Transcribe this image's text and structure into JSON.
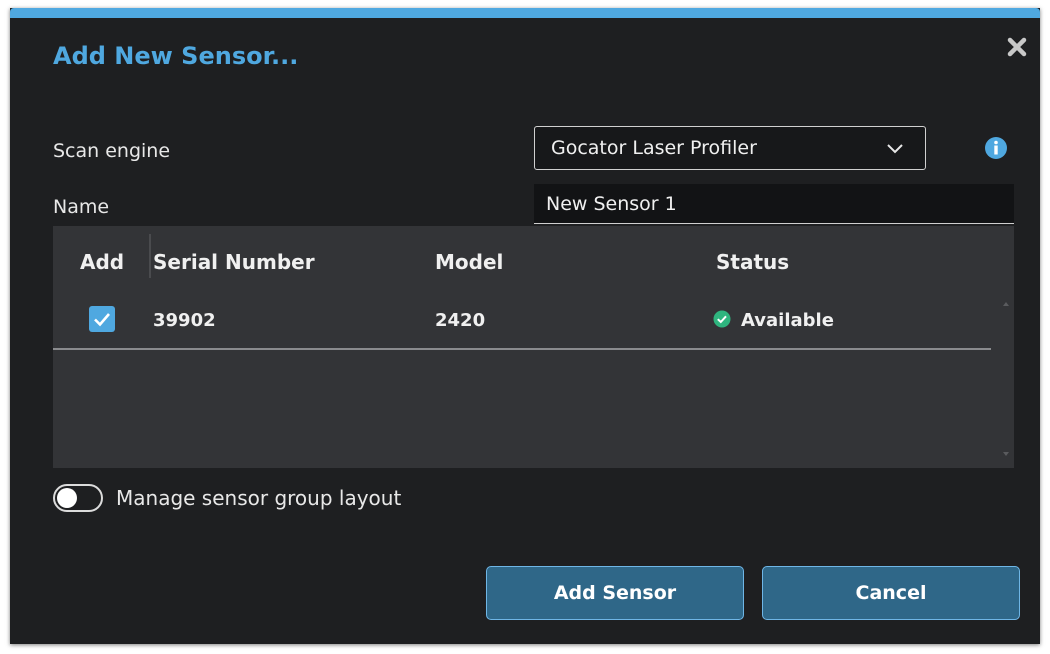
{
  "dialog": {
    "title": "Add New Sensor...",
    "scan_engine_label": "Scan engine",
    "scan_engine_value": "Gocator Laser Profiler",
    "name_label": "Name",
    "name_value": "New Sensor 1"
  },
  "table": {
    "headers": [
      "Add",
      "Serial Number",
      "Model",
      "Status"
    ],
    "rows": [
      {
        "add": true,
        "serial": "39902",
        "model": "2420",
        "status": "Available"
      }
    ]
  },
  "manage_layout": {
    "label": "Manage sensor group layout",
    "enabled": false
  },
  "buttons": {
    "add": "Add Sensor",
    "cancel": "Cancel"
  },
  "colors": {
    "accent": "#4fa8e0",
    "dialog_bg": "#1e1f21",
    "table_bg": "#333437",
    "button_bg": "#2f6788",
    "status_ok": "#2fb57f"
  },
  "icons": {
    "close": "close-icon",
    "dropdown": "chevron-down-icon",
    "info": "info-icon",
    "status": "check-circle-icon"
  }
}
